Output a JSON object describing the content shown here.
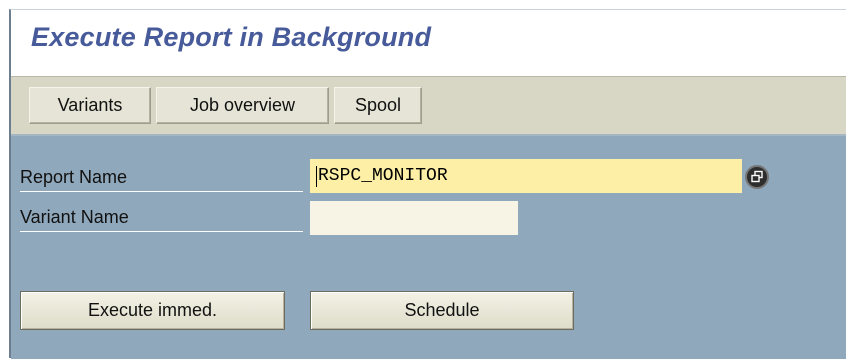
{
  "header": {
    "title": "Execute Report in Background"
  },
  "toolbar": {
    "variants_label": "Variants",
    "job_overview_label": "Job overview",
    "spool_label": "Spool"
  },
  "form": {
    "report_name_label": "Report Name",
    "report_name_value": "RSPC_MONITOR",
    "variant_name_label": "Variant Name",
    "variant_name_value": ""
  },
  "actions": {
    "execute_label": "Execute immed.",
    "schedule_label": "Schedule"
  },
  "colors": {
    "title": "#475a9a",
    "toolbar_bg": "#d8d7c6",
    "content_bg": "#90a8bb",
    "required_field_bg": "#fdf0a6",
    "optional_field_bg": "#f7f3e5"
  },
  "icons": {
    "value_help": "possible-entries-icon"
  }
}
